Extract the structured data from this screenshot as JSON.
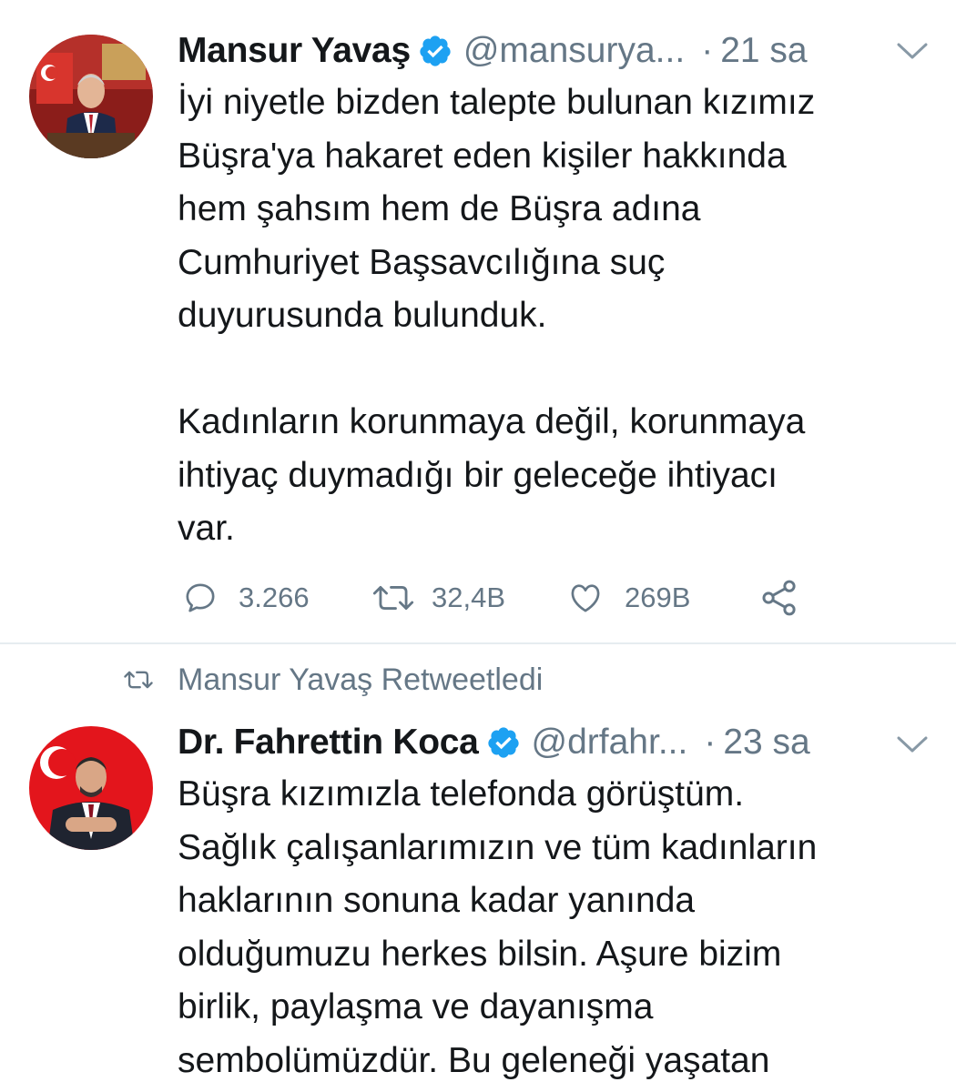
{
  "tweet1": {
    "name": "Mansur Yavaş",
    "handle": "@mansurya...",
    "separator": "·",
    "time": "21 sa",
    "lines": [
      "İyi niyetle bizden talepte bulunan kızımız",
      "Büşra'ya hakaret eden kişiler hakkında",
      "hem şahsım hem de Büşra adına",
      "Cumhuriyet Başsavcılığına suç",
      "duyurusunda bulunduk."
    ],
    "lines2": [
      "Kadınların korunmaya değil, korunmaya",
      "ihtiyaç duymadığı bir geleceğe ihtiyacı",
      "var."
    ],
    "actions": {
      "reply_count": "3.266",
      "retweet_count": "32,4B",
      "like_count": "269B"
    }
  },
  "retweet_context": {
    "label": "Mansur Yavaş Retweetledi"
  },
  "tweet2": {
    "name": "Dr. Fahrettin Koca",
    "handle": "@drfahr...",
    "separator": "·",
    "time": "23 sa",
    "lines": [
      "Büşra kızımızla telefonda görüştüm.",
      "Sağlık çalışanlarımızın ve tüm kadınların",
      "haklarının sonuna kadar yanında",
      "olduğumuzu herkes bilsin. Aşure bizim",
      "birlik, paylaşma ve dayanışma",
      "sembolümüzdür. Bu geleneği yaşatan"
    ]
  },
  "icons": {
    "verified": "verified-badge-icon",
    "caret": "chevron-down-icon",
    "reply": "reply-icon",
    "retweet": "retweet-icon",
    "like": "heart-icon",
    "share": "share-icon"
  },
  "colors": {
    "text": "#14171a",
    "secondary": "#657786",
    "verified": "#1da1f2",
    "divider": "#e6ecf0"
  }
}
